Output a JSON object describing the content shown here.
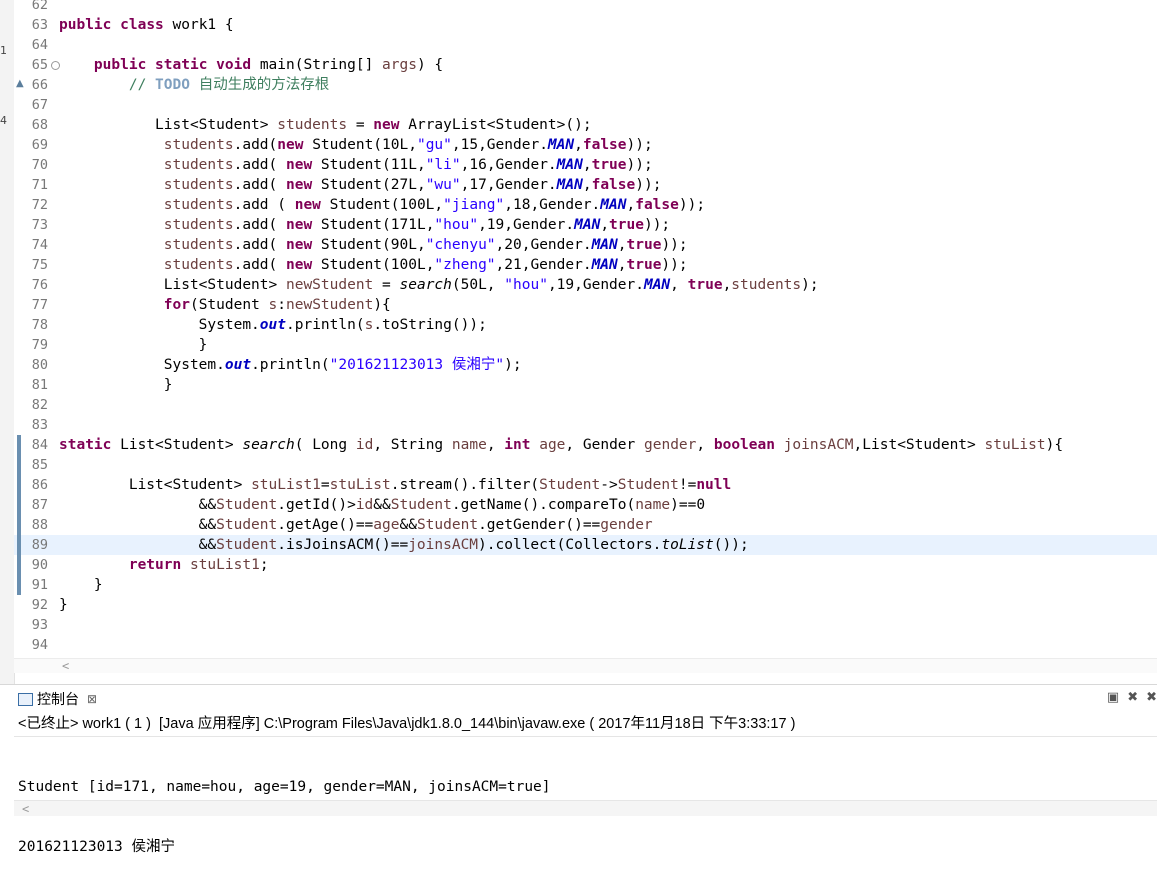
{
  "left_strip": {
    "mark_a": "1",
    "mark_b": "4"
  },
  "editor": {
    "fold_glyph": "⊖",
    "warn_glyph": "▲",
    "lines": [
      {
        "n": "62",
        "text": ""
      },
      {
        "n": "63",
        "text": "public class work1 {"
      },
      {
        "n": "64",
        "text": ""
      },
      {
        "n": "65",
        "text": "    public static void main(String[] args) {"
      },
      {
        "n": "66",
        "text": "        // TODO 自动生成的方法存根"
      },
      {
        "n": "67",
        "text": ""
      },
      {
        "n": "68",
        "text": "           List<Student> students = new ArrayList<Student>();"
      },
      {
        "n": "69",
        "text": "            students.add(new Student(10L,\"gu\",15,Gender.MAN,false));"
      },
      {
        "n": "70",
        "text": "            students.add( new Student(11L,\"li\",16,Gender.MAN,true));"
      },
      {
        "n": "71",
        "text": "            students.add( new Student(27L,\"wu\",17,Gender.MAN,false));"
      },
      {
        "n": "72",
        "text": "            students.add ( new Student(100L,\"jiang\",18,Gender.MAN,false));"
      },
      {
        "n": "73",
        "text": "            students.add( new Student(171L,\"hou\",19,Gender.MAN,true));"
      },
      {
        "n": "74",
        "text": "            students.add( new Student(90L,\"chenyu\",20,Gender.MAN,true));"
      },
      {
        "n": "75",
        "text": "            students.add( new Student(100L,\"zheng\",21,Gender.MAN,true));"
      },
      {
        "n": "76",
        "text": "            List<Student> newStudent = search(50L, \"hou\",19,Gender.MAN, true,students);"
      },
      {
        "n": "77",
        "text": "            for(Student s:newStudent){"
      },
      {
        "n": "78",
        "text": "                System.out.println(s.toString());"
      },
      {
        "n": "79",
        "text": "                }"
      },
      {
        "n": "80",
        "text": "            System.out.println(\"201621123013 侯湘宁\");"
      },
      {
        "n": "81",
        "text": "            }"
      },
      {
        "n": "82",
        "text": ""
      },
      {
        "n": "83",
        "text": ""
      },
      {
        "n": "84",
        "text": "static List<Student> search( Long id, String name, int age, Gender gender, boolean joinsACM,List<Student> stuList){"
      },
      {
        "n": "85",
        "text": ""
      },
      {
        "n": "86",
        "text": "        List<Student> stuList1=stuList.stream().filter(Student->Student!=null"
      },
      {
        "n": "87",
        "text": "                &&Student.getId()>id&&Student.getName().compareTo(name)==0"
      },
      {
        "n": "88",
        "text": "                &&Student.getAge()==age&&Student.getGender()==gender"
      },
      {
        "n": "89",
        "text": "                &&Student.isJoinsACM()==joinsACM).collect(Collectors.toList());"
      },
      {
        "n": "90",
        "text": "        return stuList1;"
      },
      {
        "n": "91",
        "text": "    }"
      },
      {
        "n": "92",
        "text": "}"
      },
      {
        "n": "93",
        "text": ""
      },
      {
        "n": "94",
        "text": ""
      }
    ]
  },
  "console": {
    "tab_label": "控制台",
    "tab_close": "⊠",
    "tool_icons": [
      "▣",
      "✖",
      "✖"
    ],
    "status": "<已终止> work1 ( 1 )  [Java 应用程序] C:\\Program Files\\Java\\jdk1.8.0_144\\bin\\javaw.exe ( 2017年11月18日 下午3:33:17 )",
    "output": [
      "Student [id=171, name=hou, age=19, gender=MAN, joinsACM=true]",
      "201621123013 侯湘宁"
    ]
  },
  "scroll_arrow": "<"
}
